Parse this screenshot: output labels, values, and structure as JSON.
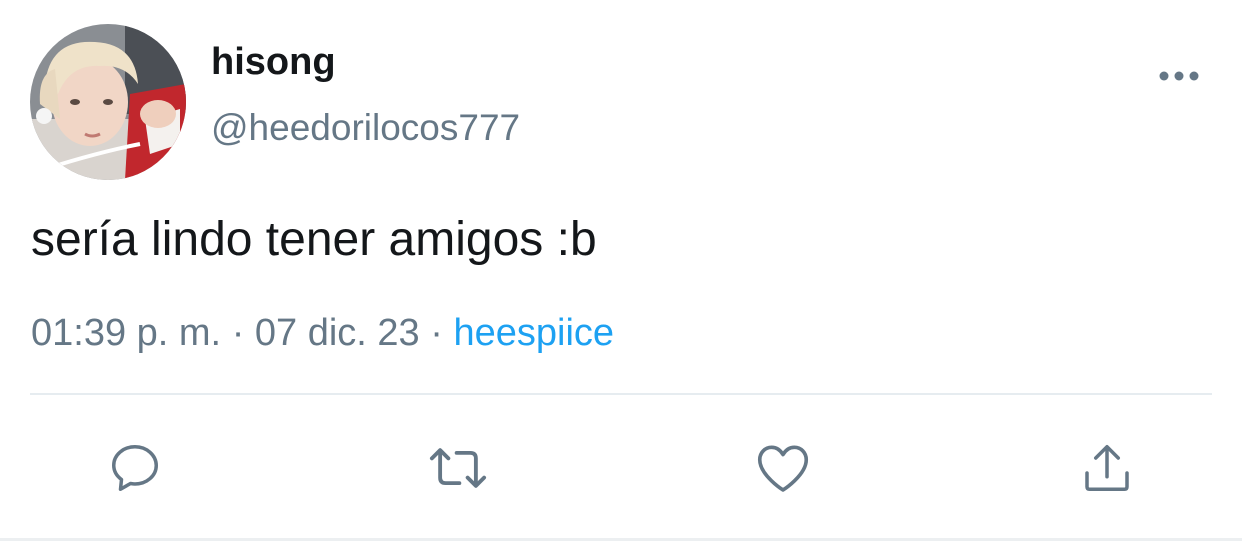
{
  "user": {
    "display_name": "hisong",
    "handle": "@heedorilocos777",
    "avatar_icon": "profile-photo"
  },
  "tweet": {
    "text": "sería lindo tener amigos :b",
    "time": "01:39 p. m.",
    "separator": "·",
    "date": "07 dic. 23",
    "source": "heespiice"
  },
  "actions": {
    "reply_icon": "reply-icon",
    "retweet_icon": "retweet-icon",
    "like_icon": "heart-icon",
    "share_icon": "share-icon",
    "more_icon": "more-icon"
  },
  "colors": {
    "text_primary": "#14171a",
    "text_secondary": "#657786",
    "link": "#1da1f2",
    "divider": "#e6ecf0"
  }
}
